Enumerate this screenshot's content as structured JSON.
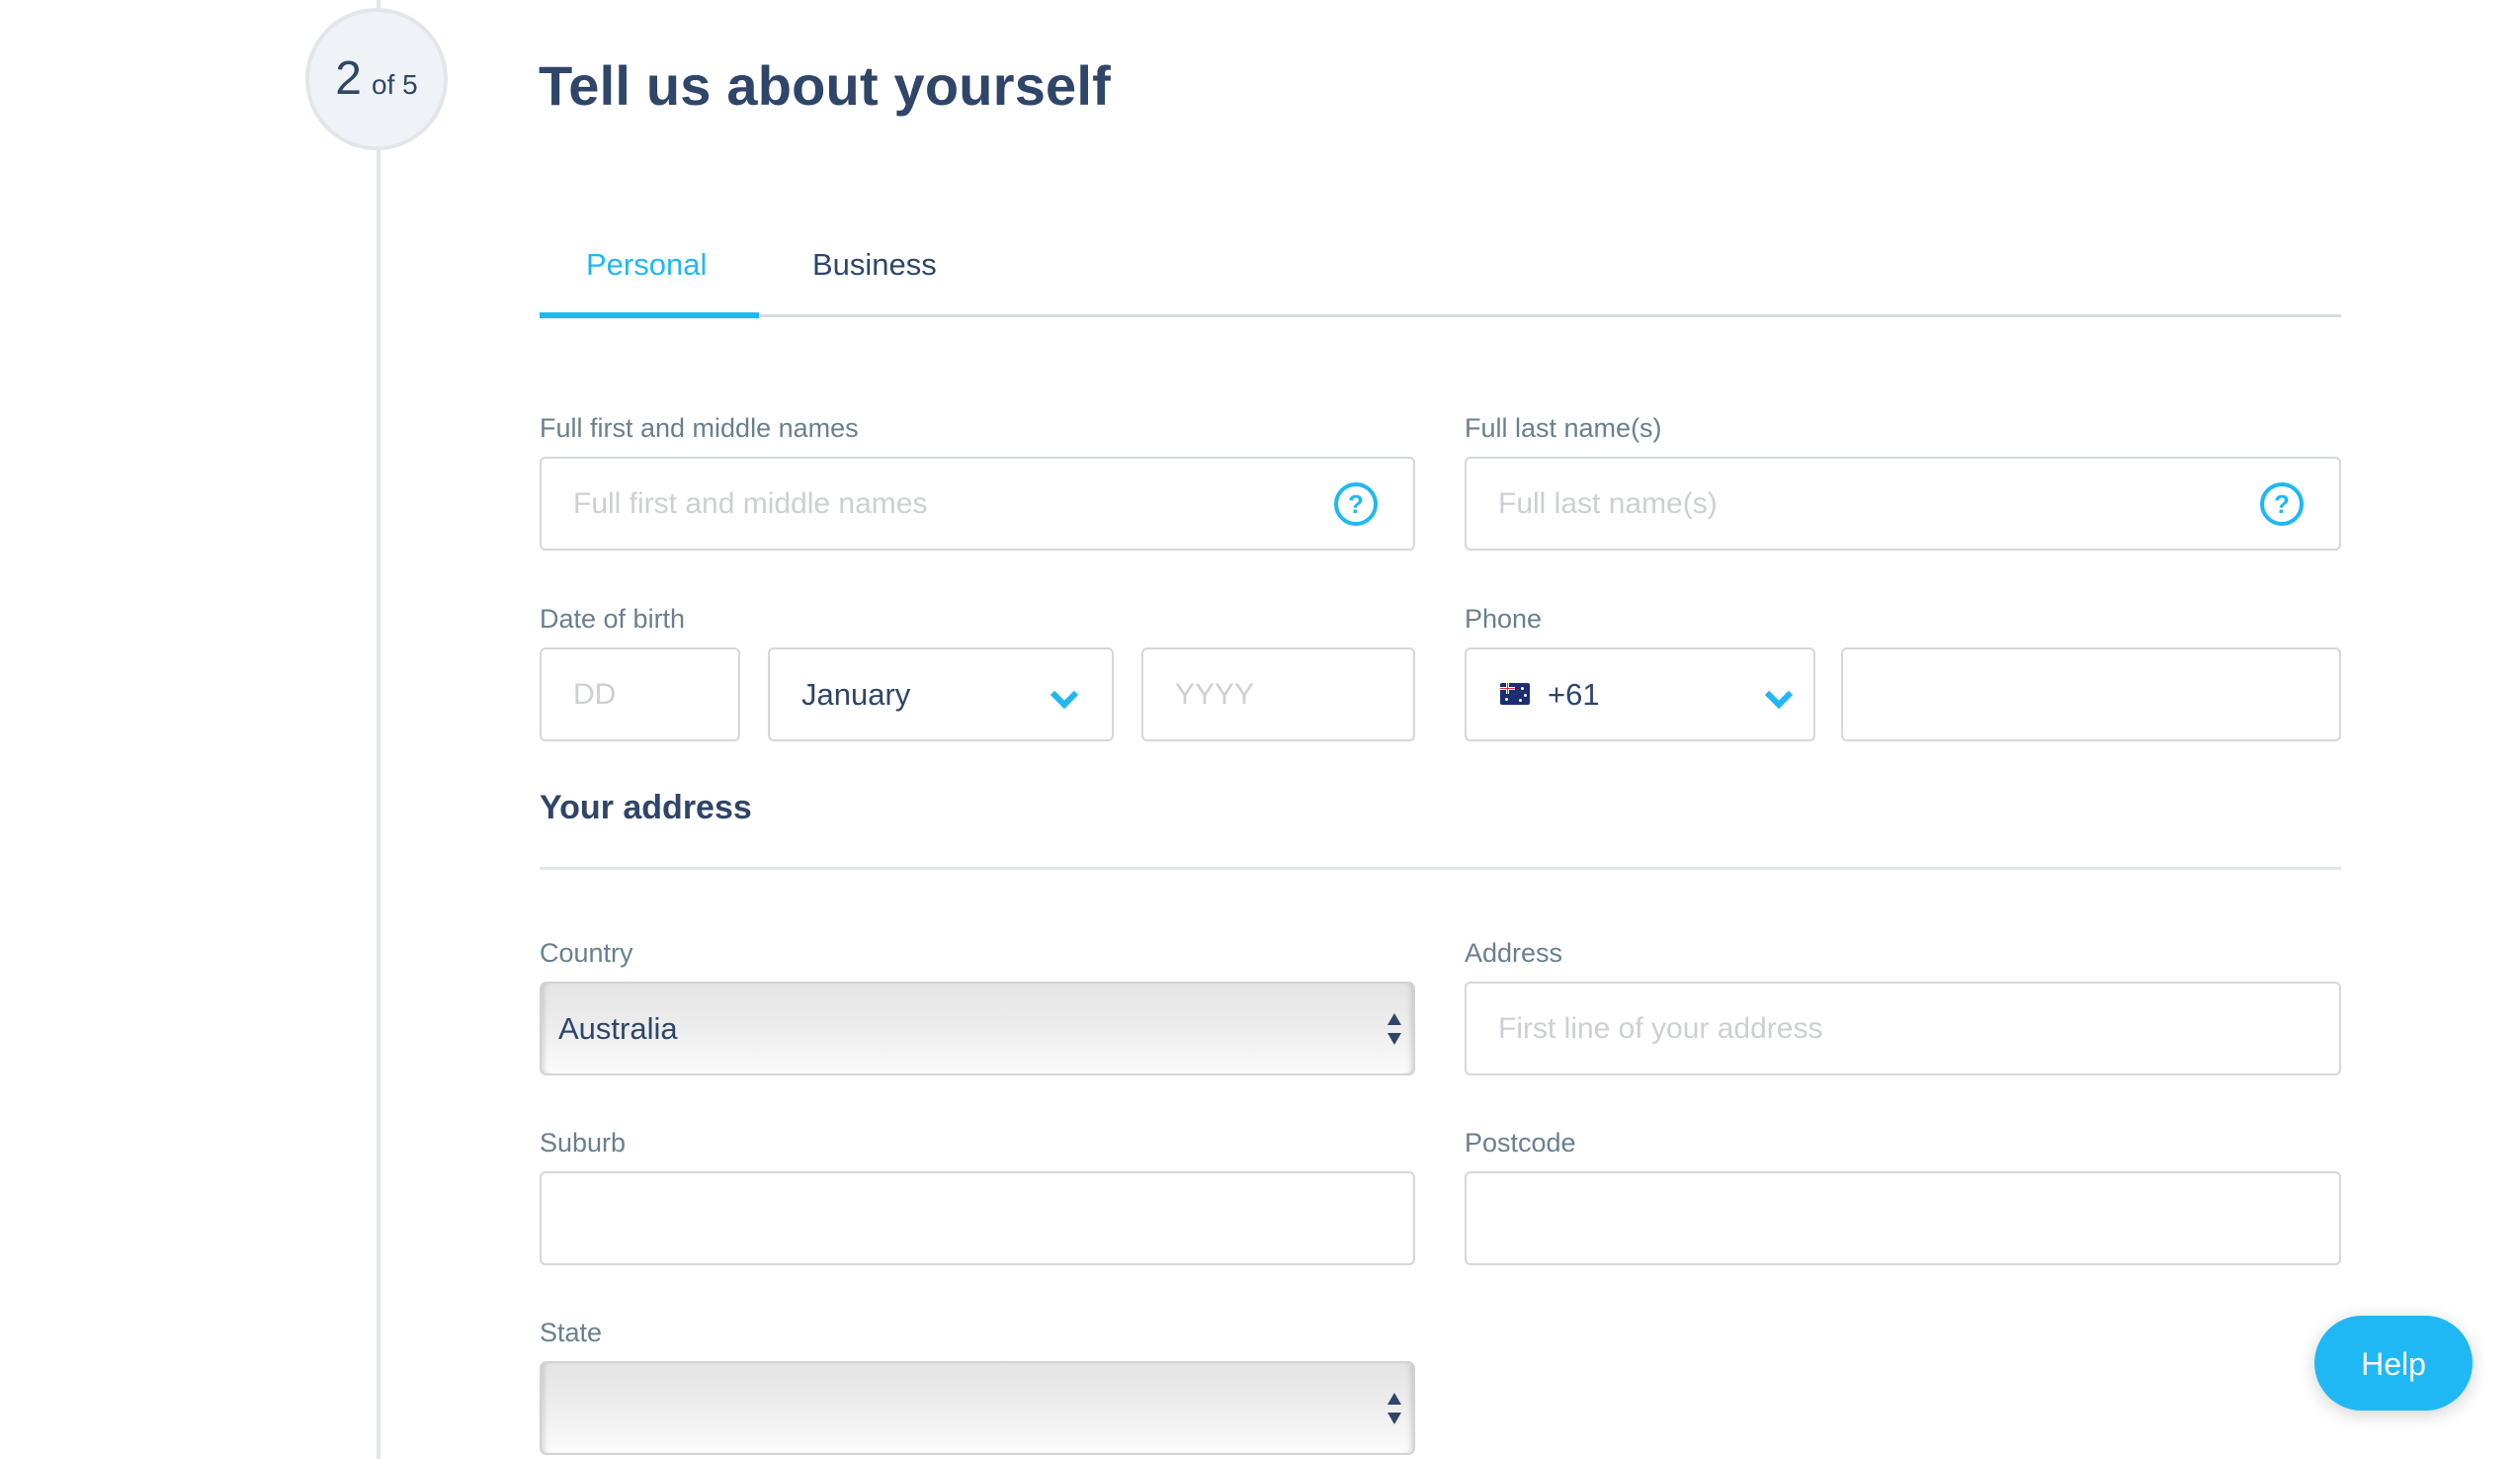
{
  "step": {
    "current": "2",
    "of_total": "of 5"
  },
  "page_title": "Tell us about yourself",
  "tabs": [
    {
      "label": "Personal",
      "active": true
    },
    {
      "label": "Business",
      "active": false
    }
  ],
  "colors": {
    "accent": "#1fb8f5",
    "text_primary": "#2f4569",
    "label": "#6a7f8d",
    "placeholder": "#ccd0d5",
    "border": "#d4d7db"
  },
  "personal": {
    "first_names": {
      "label": "Full first and middle names",
      "placeholder": "Full first and middle names",
      "value": "",
      "help_icon": "question-circle-icon"
    },
    "last_names": {
      "label": "Full last name(s)",
      "placeholder": "Full last name(s)",
      "value": "",
      "help_icon": "question-circle-icon"
    },
    "dob": {
      "label": "Date of birth",
      "day_placeholder": "DD",
      "month_value": "January",
      "year_placeholder": "YYYY"
    },
    "phone": {
      "label": "Phone",
      "country_flag": "australia-flag-icon",
      "country_code": "+61",
      "number_value": ""
    }
  },
  "address": {
    "heading": "Your address",
    "country": {
      "label": "Country",
      "value": "Australia"
    },
    "line1": {
      "label": "Address",
      "placeholder": "First line of your address",
      "value": ""
    },
    "suburb": {
      "label": "Suburb",
      "value": ""
    },
    "postcode": {
      "label": "Postcode",
      "value": ""
    },
    "state": {
      "label": "State",
      "value": ""
    }
  },
  "help_button": {
    "label": "Help"
  }
}
